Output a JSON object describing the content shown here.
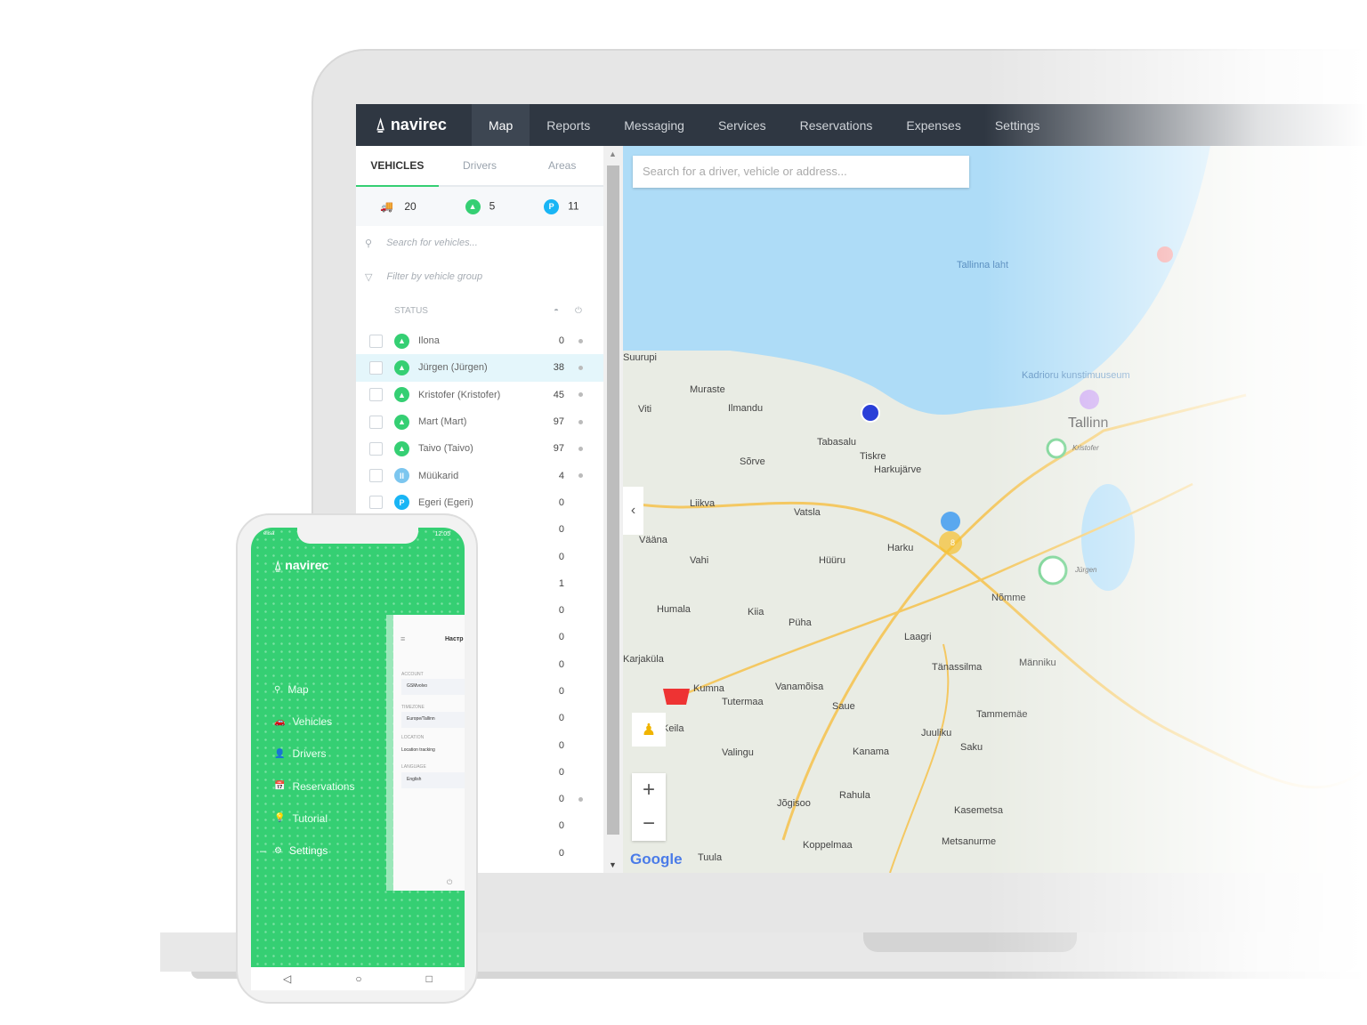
{
  "nav": {
    "brand": "navirec",
    "items": [
      "Map",
      "Reports",
      "Messaging",
      "Services",
      "Reservations",
      "Expenses",
      "Settings"
    ],
    "active": "Map"
  },
  "sidebar": {
    "tabs": [
      "VEHICLES",
      "Drivers",
      "Areas"
    ],
    "counts": {
      "total": "20",
      "moving": "5",
      "parked": "11"
    },
    "search_placeholder": "Search for vehicles...",
    "filter_placeholder": "Filter by vehicle group",
    "status_header": "STATUS",
    "rows": [
      {
        "name": "Ilona",
        "status": "moving",
        "value": "0",
        "dot": true
      },
      {
        "name": "Jürgen (Jürgen)",
        "status": "moving",
        "value": "38",
        "dot": true,
        "selected": true
      },
      {
        "name": "Kristofer (Kristofer)",
        "status": "moving",
        "value": "45",
        "dot": true
      },
      {
        "name": "Mart (Mart)",
        "status": "moving",
        "value": "97",
        "dot": true
      },
      {
        "name": "Taivo (Taivo)",
        "status": "moving",
        "value": "97",
        "dot": true
      },
      {
        "name": "Müükarid",
        "status": "paused",
        "value": "4",
        "dot": true
      },
      {
        "name": "Egeri (Egeri)",
        "status": "parked",
        "value": "0"
      },
      {
        "value": "0"
      },
      {
        "value": "0"
      },
      {
        "value": "1"
      },
      {
        "value": "0"
      },
      {
        "value": "0"
      },
      {
        "value": "0"
      },
      {
        "value": "0"
      },
      {
        "value": "0"
      },
      {
        "value": "0"
      },
      {
        "value": "0"
      },
      {
        "value": "0",
        "dot": true
      },
      {
        "value": "0"
      },
      {
        "value": "0"
      }
    ]
  },
  "map": {
    "search_placeholder": "Search for a driver, vehicle or address...",
    "attribution": "Google",
    "cluster_count": "8",
    "labels": [
      "Tallinna laht",
      "Muraste",
      "Ilmandu",
      "Vääna",
      "Tabasalu",
      "Tiskre",
      "Harkujärve",
      "Vatsla",
      "Harku",
      "Hüüru",
      "Vahi",
      "Humala",
      "Kiia",
      "Püha",
      "Laagri",
      "Tänassilma",
      "Kumna",
      "Tutermaa",
      "Vanamõisa",
      "Saue",
      "Keila",
      "Valingu",
      "Kanama",
      "Juuliku",
      "Saku",
      "Jõgisoo",
      "Rahula",
      "Kasemetsa",
      "Koppelmaa",
      "Metsanurme",
      "Tuula",
      "Liikva",
      "Sõrve",
      "Karjaküla",
      "Kadrioru kunstimuuseum",
      "Tallinn",
      "Kristofer",
      "Jürgen",
      "Nõmme",
      "Männiku",
      "Tammemäe",
      "Viti",
      "Suurupi"
    ]
  },
  "colors": {
    "accent": "#35cf73",
    "nav": "#2f3742",
    "parked": "#19b5f5",
    "water": "#aedcf7"
  },
  "phone": {
    "status_left": "elisa",
    "time": "12:05",
    "brand": "navirec",
    "menu": [
      "Map",
      "Vehicles",
      "Drivers",
      "Reservations",
      "Tutorial",
      "Settings"
    ],
    "card": {
      "title": "Настр",
      "account_label": "ACCOUNT",
      "account": "GSMvolvo",
      "timezone_label": "TIMEZONE",
      "timezone": "Europe/Tallinn",
      "location_label": "LOCATION",
      "location": "Location tracking",
      "language_label": "LANGUAGE",
      "language": "English"
    }
  }
}
